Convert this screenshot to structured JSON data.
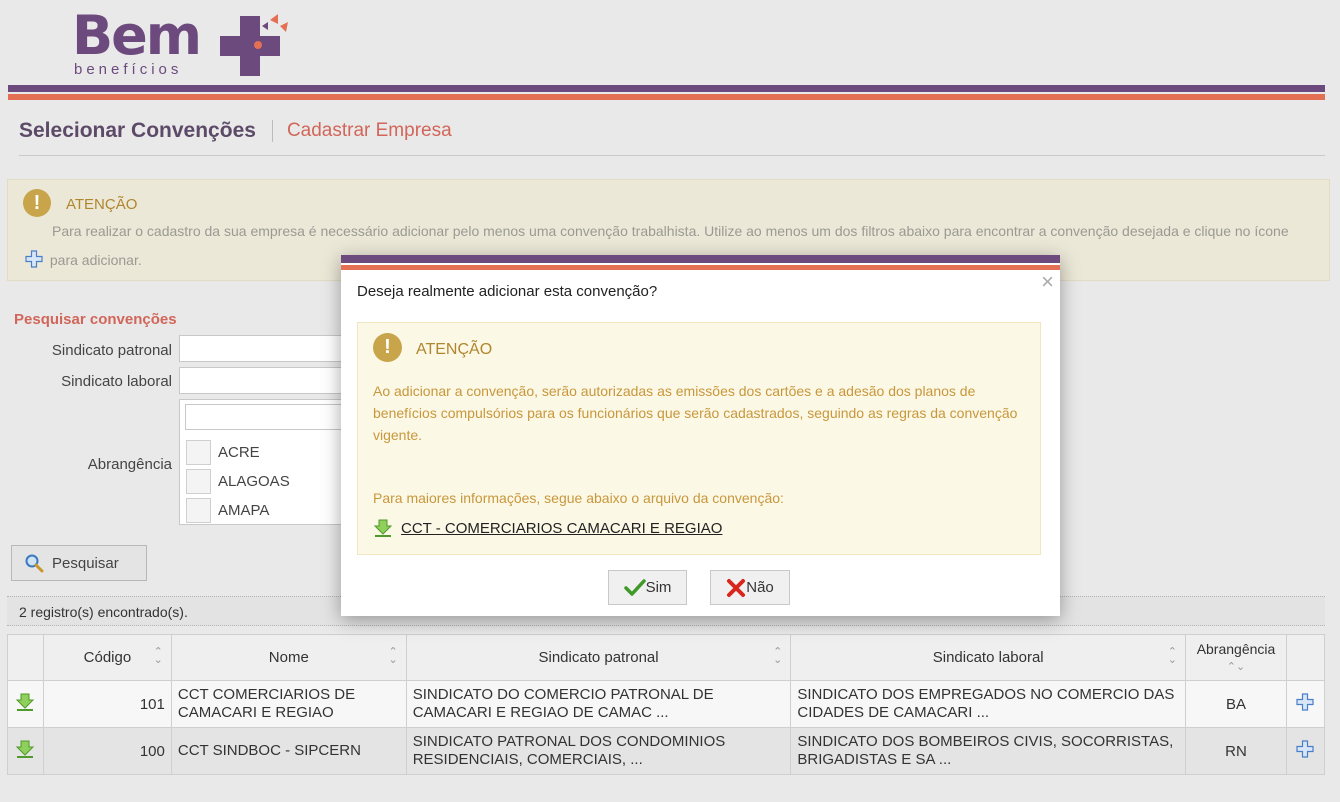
{
  "logo": {
    "name": "Bem",
    "sub": "benefícios"
  },
  "header": {
    "title": "Selecionar Convenções",
    "link": "Cadastrar Empresa"
  },
  "page_alert": {
    "title": "ATENÇÃO",
    "text_before": "Para realizar o cadastro da sua empresa é necessário adicionar pelo menos uma convenção trabalhista. Utilize ao menos um dos filtros abaixo para encontrar a convenção desejada e clique no ícone",
    "text_after": "para adicionar."
  },
  "search": {
    "title": "Pesquisar convenções",
    "patronal_label": "Sindicato patronal",
    "laboral_label": "Sindicato laboral",
    "abrangencia_label": "Abrangência",
    "options": [
      "ACRE",
      "ALAGOAS",
      "AMAPA"
    ],
    "button": "Pesquisar"
  },
  "records": "2 registro(s) encontrado(s).",
  "table": {
    "headers": [
      "Código",
      "Nome",
      "Sindicato patronal",
      "Sindicato laboral",
      "Abrangência"
    ],
    "rows": [
      {
        "codigo": "101",
        "nome": "CCT COMERCIARIOS DE CAMACARI E REGIAO",
        "patronal": "SINDICATO DO COMERCIO PATRONAL DE CAMACARI E REGIAO DE CAMAC ...",
        "laboral": "SINDICATO DOS EMPREGADOS NO COMERCIO DAS CIDADES DE CAMACARI ...",
        "abrangencia": "BA"
      },
      {
        "codigo": "100",
        "nome": "CCT SINDBOC - SIPCERN",
        "patronal": "SINDICATO PATRONAL DOS CONDOMINIOS RESIDENCIAIS, COMERCIAIS, ...",
        "laboral": "SINDICATO DOS BOMBEIROS CIVIS, SOCORRISTAS, BRIGADISTAS E SA ...",
        "abrangencia": "RN"
      }
    ]
  },
  "modal": {
    "question": "Deseja realmente adicionar esta convenção?",
    "alert_title": "ATENÇÃO",
    "alert_text": "Ao adicionar a convenção, serão autorizadas as emissões dos cartões e a adesão dos planos de benefícios compulsórios para os funcionários que serão cadastrados, seguindo as regras da convenção vigente.",
    "info": "Para maiores informações, segue abaixo o arquivo da convenção:",
    "file": "CCT - COMERCIARIOS CAMACARI E REGIAO",
    "yes": "Sim",
    "no": "Não"
  },
  "colors": {
    "purple": "#6d4a7e",
    "orange": "#e47053",
    "warning": "#c8a54a",
    "accent_blue": "#4a7fc8"
  }
}
